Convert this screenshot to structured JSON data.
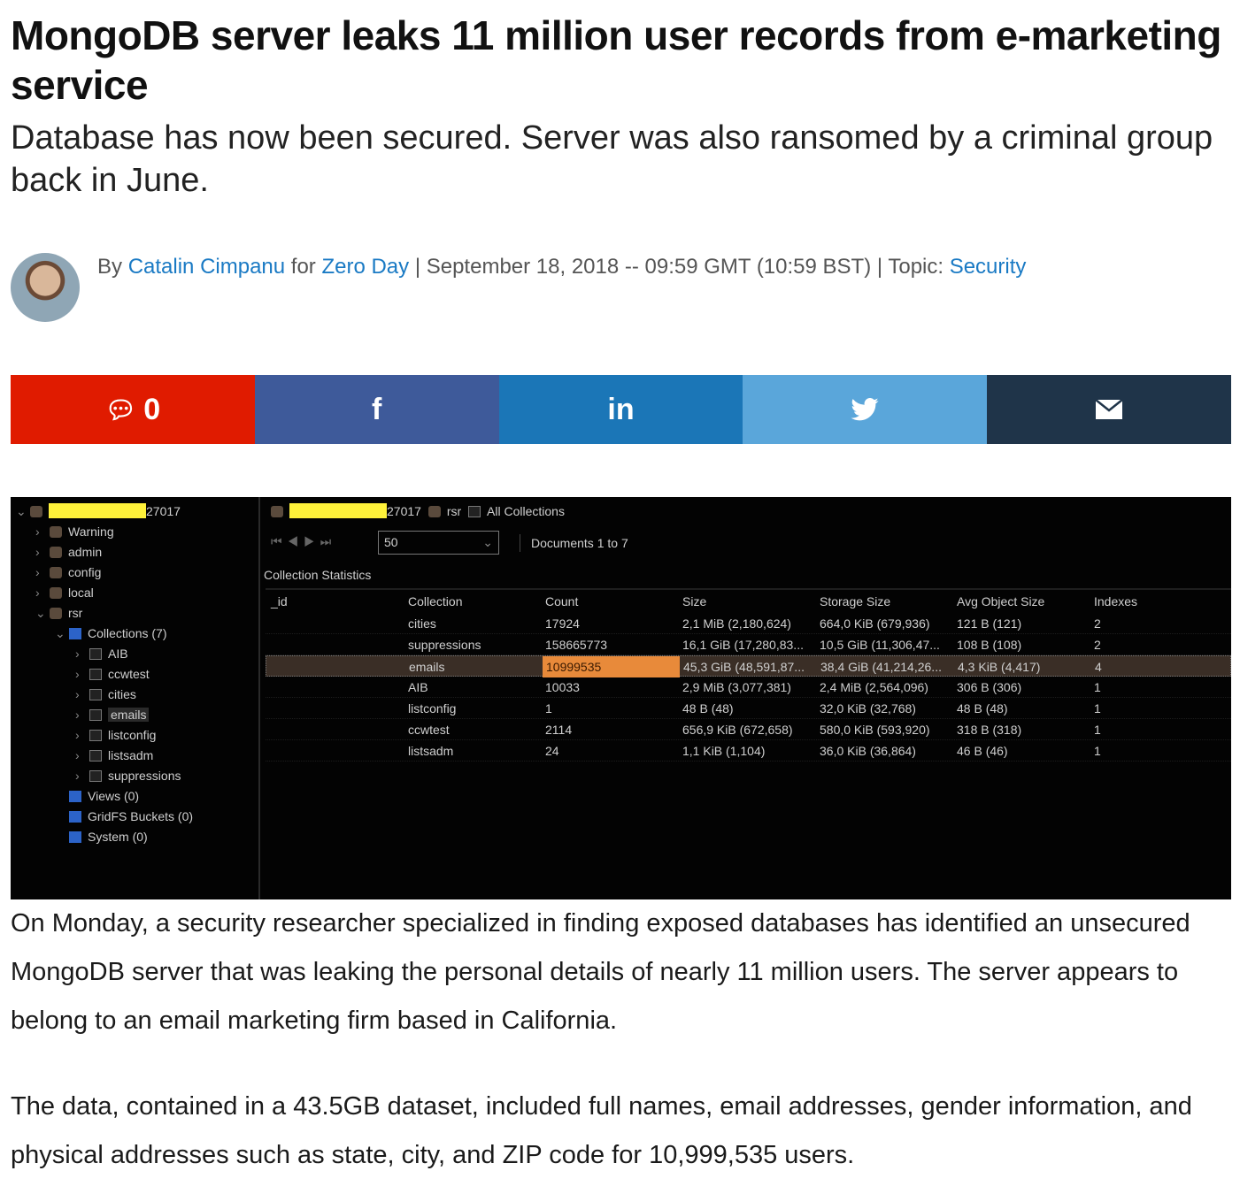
{
  "article": {
    "title": "MongoDB server leaks 11 million user records from e-marketing service",
    "subtitle": "Database has now been secured. Server was also ransomed by a criminal group back in June.",
    "byline": {
      "by": "By ",
      "author": "Catalin Cimpanu",
      "for": " for ",
      "blog": "Zero Day",
      "date": " | September 18, 2018 -- 09:59 GMT (10:59 BST) | Topic: ",
      "topic": "Security"
    },
    "paragraphs": [
      "On Monday, a security researcher specialized in finding exposed databases has identified an unsecured MongoDB server that was leaking the personal details of nearly 11 million users. The server appears to belong to an email marketing firm based in California.",
      "The data, contained in a 43.5GB dataset, included full names, email addresses, gender information, and physical addresses such as state, city, and ZIP code for 10,999,535 users."
    ]
  },
  "share": {
    "comments_count": "0",
    "facebook": "f",
    "linkedin": "in",
    "colors": {
      "comments": "#e01b00",
      "facebook": "#3e5a9a",
      "linkedin": "#1b76b7",
      "twitter": "#5aa6da",
      "email": "#1f3449"
    }
  },
  "screenshot": {
    "tree": {
      "root": "27017",
      "items": [
        {
          "label": "Warning",
          "type": "db",
          "level": 1,
          "chev": "›"
        },
        {
          "label": "admin",
          "type": "db",
          "level": 1,
          "chev": "›"
        },
        {
          "label": "config",
          "type": "db",
          "level": 1,
          "chev": "›"
        },
        {
          "label": "local",
          "type": "db",
          "level": 1,
          "chev": "›"
        },
        {
          "label": "rsr",
          "type": "db",
          "level": 1,
          "chev": "⌄"
        },
        {
          "label": "Collections (7)",
          "type": "fold",
          "level": 2,
          "chev": "⌄"
        },
        {
          "label": "AIB",
          "type": "col",
          "level": 3,
          "chev": "›"
        },
        {
          "label": "ccwtest",
          "type": "col",
          "level": 3,
          "chev": "›"
        },
        {
          "label": "cities",
          "type": "col",
          "level": 3,
          "chev": "›"
        },
        {
          "label": "emails",
          "type": "col",
          "level": 3,
          "chev": "›"
        },
        {
          "label": "listconfig",
          "type": "col",
          "level": 3,
          "chev": "›"
        },
        {
          "label": "listsadm",
          "type": "col",
          "level": 3,
          "chev": "›"
        },
        {
          "label": "suppressions",
          "type": "col",
          "level": 3,
          "chev": "›"
        },
        {
          "label": "Views (0)",
          "type": "fold",
          "level": 2,
          "chev": ""
        },
        {
          "label": "GridFS Buckets (0)",
          "type": "fold",
          "level": 2,
          "chev": ""
        },
        {
          "label": "System (0)",
          "type": "fold",
          "level": 2,
          "chev": ""
        }
      ]
    },
    "breadcrumb": {
      "port": "27017",
      "db": "rsr",
      "collections": "All Collections"
    },
    "page_size": "50",
    "documents_label": "Documents 1 to 7",
    "stats_label": "Collection Statistics",
    "columns": [
      "_id",
      "Collection",
      "Count",
      "Size",
      "Storage Size",
      "Avg Object Size",
      "Indexes"
    ],
    "rows": [
      [
        "",
        "cities",
        "17924",
        "2,1 MiB  (2,180,624)",
        "664,0 KiB  (679,936)",
        "121 B  (121)",
        "2"
      ],
      [
        "",
        "suppressions",
        "158665773",
        "16,1 GiB  (17,280,83...",
        "10,5 GiB  (11,306,47...",
        "108 B  (108)",
        "2"
      ],
      [
        "",
        "emails",
        "10999535",
        "45,3 GiB  (48,591,87...",
        "38,4 GiB  (41,214,26...",
        "4,3 KiB  (4,417)",
        "4"
      ],
      [
        "",
        "AIB",
        "10033",
        "2,9 MiB  (3,077,381)",
        "2,4 MiB  (2,564,096)",
        "306 B  (306)",
        "1"
      ],
      [
        "",
        "listconfig",
        "1",
        "48 B  (48)",
        "32,0 KiB  (32,768)",
        "48 B  (48)",
        "1"
      ],
      [
        "",
        "ccwtest",
        "2114",
        "656,9 KiB  (672,658)",
        "580,0 KiB  (593,920)",
        "318 B  (318)",
        "1"
      ],
      [
        "",
        "listsadm",
        "24",
        "1,1 KiB  (1,104)",
        "36,0 KiB  (36,864)",
        "46 B  (46)",
        "1"
      ]
    ],
    "highlight_row": 2
  }
}
